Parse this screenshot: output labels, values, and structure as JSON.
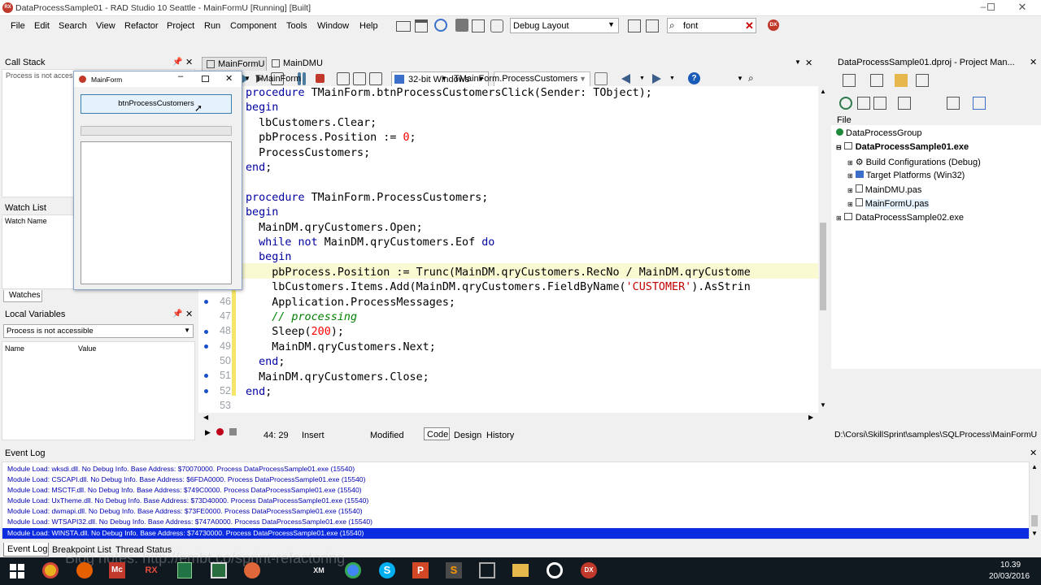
{
  "window": {
    "title": "DataProcessSample01 - RAD Studio 10 Seattle - MainFormU [Running] [Built]"
  },
  "menu": [
    "File",
    "Edit",
    "Search",
    "View",
    "Refactor",
    "Project",
    "Run",
    "Component",
    "Tools",
    "Window",
    "Help"
  ],
  "toolbar": {
    "layout_value": "Debug Layout",
    "search_value": "font",
    "platform_value": "32-bit Windows",
    "config_value": ""
  },
  "callstack": {
    "title": "Call Stack",
    "status": "Process is not accessible"
  },
  "watch": {
    "title": "Watch List",
    "col": "Watch Name",
    "tab": "Watches"
  },
  "locals": {
    "title": "Local Variables",
    "combo": "Process is not accessible",
    "col_name": "Name",
    "col_value": "Value"
  },
  "running_form": {
    "title": "MainForm",
    "button": "btnProcessCustomers"
  },
  "editor": {
    "tabs": [
      "MainFormU",
      "MainDMU"
    ],
    "class_combo": "TMainForm",
    "method_combo": "TMainForm.ProcessCustomers",
    "line_numbers": [
      "46",
      "47",
      "48",
      "49",
      "50",
      "51",
      "52",
      "53"
    ],
    "code_lines": [
      "procedure TMainForm.btnProcessCustomersClick(Sender: TObject);",
      "begin",
      "  lbCustomers.Clear;",
      "  pbProcess.Position := 0;",
      "  ProcessCustomers;",
      "end;",
      "",
      "procedure TMainForm.ProcessCustomers;",
      "begin",
      "  MainDM.qryCustomers.Open;",
      "  while not MainDM.qryCustomers.Eof do",
      "  begin",
      "    pbProcess.Position := Trunc(MainDM.qryCustomers.RecNo / MainDM.qryCustome",
      "    lbCustomers.Items.Add(MainDM.qryCustomers.FieldByName('CUSTOMER').AsStrin",
      "    Application.ProcessMessages;",
      "    // processing",
      "    Sleep(200);",
      "    MainDM.qryCustomers.Next;",
      "  end;",
      "  MainDM.qryCustomers.Close;",
      "end;"
    ],
    "status": {
      "position": "44: 29",
      "mode": "Insert",
      "modified": "Modified",
      "tabs": [
        "Code",
        "Design",
        "History"
      ]
    }
  },
  "project_manager": {
    "title": "DataProcessSample01.dproj - Project Man...",
    "header": "File",
    "items": [
      "DataProcessGroup",
      "DataProcessSample01.exe",
      "Build Configurations (Debug)",
      "Target Platforms (Win32)",
      "MainDMU.pas",
      "MainFormU.pas",
      "DataProcessSample02.exe"
    ],
    "path": "D:\\Corsi\\SkillSprint\\samples\\SQLProcess\\MainFormU"
  },
  "event_log": {
    "title": "Event Log",
    "lines": [
      "Module Load: wksdi.dll. No Debug Info. Base Address: $70070000. Process DataProcessSample01.exe (15540)",
      "Module Load: CSCAPI.dll. No Debug Info. Base Address: $6FDA0000. Process DataProcessSample01.exe (15540)",
      "Module Load: MSCTF.dll. No Debug Info. Base Address: $749C0000. Process DataProcessSample01.exe (15540)",
      "Module Load: UxTheme.dll. No Debug Info. Base Address: $73D40000. Process DataProcessSample01.exe (15540)",
      "Module Load: dwmapi.dll. No Debug Info. Base Address: $73FE0000. Process DataProcessSample01.exe (15540)",
      "Module Load: WTSAPI32.dll. No Debug Info. Base Address: $747A0000. Process DataProcessSample01.exe (15540)",
      "Module Load: WINSTA.dll. No Debug Info. Base Address: $74730000. Process DataProcessSample01.exe (15540)"
    ],
    "tabs": [
      "Event Log",
      "Breakpoint List",
      "Thread Status"
    ]
  },
  "taskbar": {
    "time": "10.39",
    "date": "20/03/2016",
    "overlay": "Blog notes: http://embt.co/sprint-refactoring",
    "dx_label": "DX"
  },
  "colors": {
    "selection": "#0a2bdf",
    "editor_bg": "#ffffff",
    "keyword": "#0000a0",
    "gutter_mark": "#f5e66a"
  }
}
